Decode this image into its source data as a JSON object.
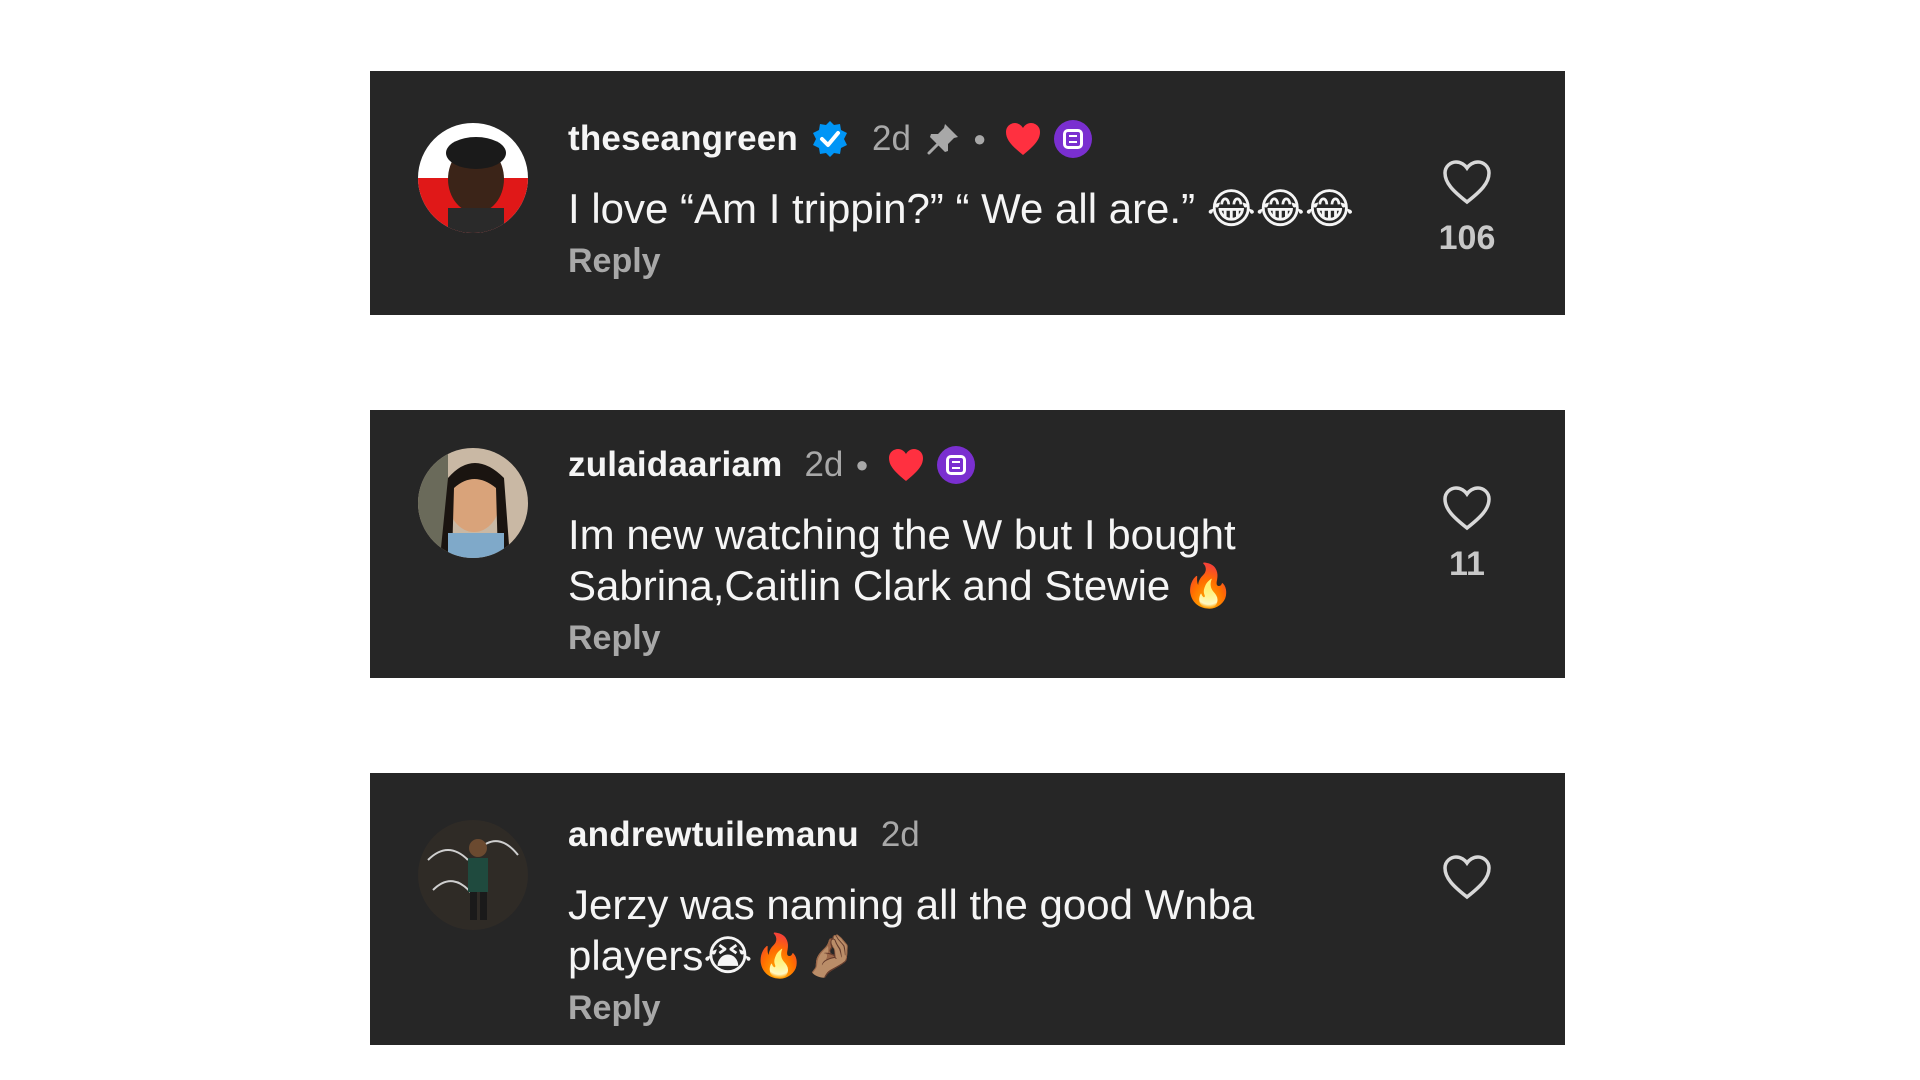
{
  "comments": [
    {
      "username": "theseangreen",
      "verified": true,
      "time": "2d",
      "pinned": true,
      "text": "I love “Am I trippin?” “ We all are.” 😂😂😂",
      "reply_label": "Reply",
      "like_count": "106",
      "creator_liked": true
    },
    {
      "username": "zulaidaariam",
      "time": "2d",
      "text_line1": "Im new watching the W but I bought",
      "text_line2": "Sabrina,Caitlin Clark and Stewie 🔥",
      "reply_label": "Reply",
      "like_count": "11",
      "creator_liked": true
    },
    {
      "username": "andrewtuilemanu",
      "time": "2d",
      "text_line1": "Jerzy was naming all the good Wnba",
      "text_line2": "players😭🔥🤌🏽",
      "reply_label": "Reply",
      "like_count": ""
    }
  ],
  "colors": {
    "card_bg": "#262626",
    "text": "#f5f5f5",
    "muted": "#a8a8a8",
    "verified_blue": "#0095f6",
    "heart_red": "#ff3040",
    "creator_purple": "#7a2fd0"
  },
  "icons": {
    "verified": "verified-badge-icon",
    "pin": "pin-icon",
    "heart_badge": "heart-icon",
    "creator_badge": "creator-badge-icon",
    "like": "like-heart-icon"
  }
}
